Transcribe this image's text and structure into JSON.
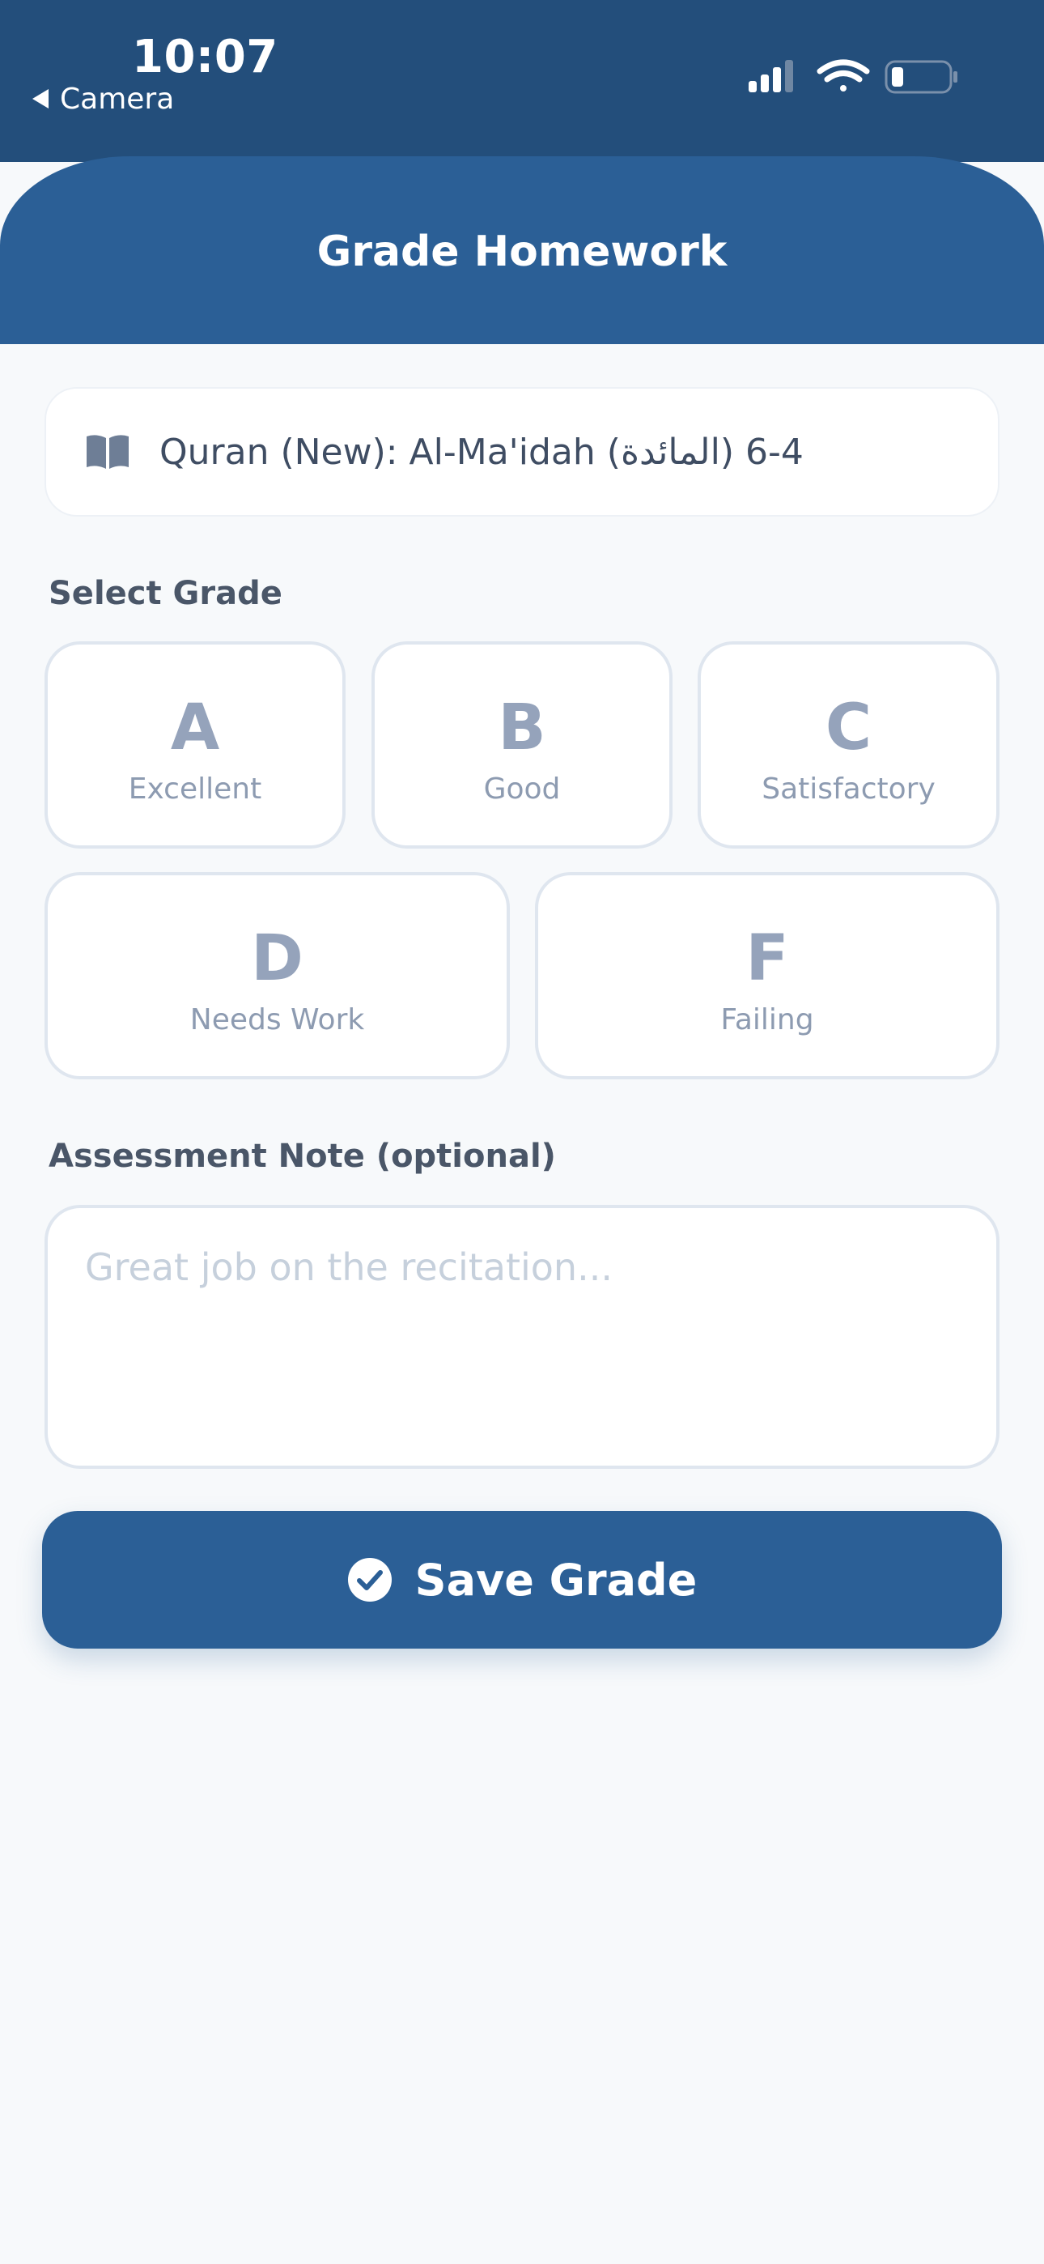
{
  "status_bar": {
    "time": "10:07",
    "back_app": "Camera",
    "icons": [
      "cellular-signal-icon",
      "wifi-icon",
      "battery-icon"
    ]
  },
  "header": {
    "title": "Grade Homework"
  },
  "assignment": {
    "icon": "book-icon",
    "text": "Quran (New): Al-Ma'idah (المائدة) 4-6"
  },
  "grade_section": {
    "label": "Select Grade",
    "grades": [
      {
        "letter": "A",
        "description": "Excellent"
      },
      {
        "letter": "B",
        "description": "Good"
      },
      {
        "letter": "C",
        "description": "Satisfactory"
      },
      {
        "letter": "D",
        "description": "Needs Work"
      },
      {
        "letter": "F",
        "description": "Failing"
      }
    ]
  },
  "note_section": {
    "label": "Assessment Note (optional)",
    "value": "",
    "placeholder": "Great job on the recitation..."
  },
  "save_button": {
    "label": "Save Grade",
    "icon": "check-circle-icon"
  },
  "colors": {
    "status_bar_bg": "#234e7b",
    "header_bg": "#2b5f96",
    "accent": "#2b5f96",
    "page_bg": "#f7f9fb"
  }
}
